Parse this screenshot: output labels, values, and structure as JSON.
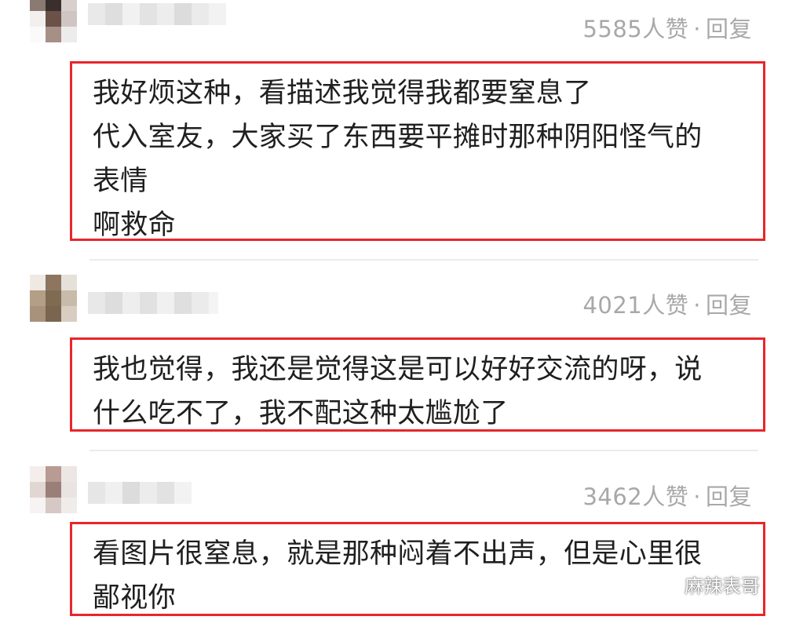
{
  "comments": [
    {
      "likes": "5585人赞",
      "separator": "·",
      "reply": "回复",
      "lines": [
        "我好烦这种，看描述我觉得我都要窒息了",
        "代入室友，大家买了东西要平摊时那种阴阳怪气的",
        "表情",
        "啊救命"
      ]
    },
    {
      "likes": "4021人赞",
      "separator": "·",
      "reply": "回复",
      "lines": [
        "我也觉得，我还是觉得这是可以好好交流的呀，说",
        "什么吃不了，我不配这种太尴尬了"
      ]
    },
    {
      "likes": "3462人赞",
      "separator": "·",
      "reply": "回复",
      "lines": [
        "看图片很窒息，就是那种闷着不出声，但是心里很",
        "鄙视你"
      ]
    }
  ],
  "watermark": {
    "text": "麻辣表哥",
    "icon": "wechat-icon"
  },
  "colors": {
    "highlight_border": "#e8262b",
    "meta_text": "#a8a8a8",
    "divider": "#ececec"
  }
}
